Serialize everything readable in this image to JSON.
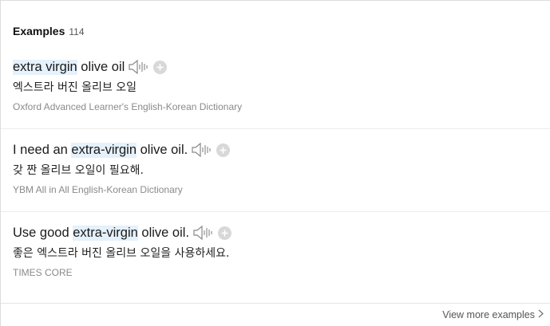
{
  "examples": {
    "title": "Examples",
    "count": "114",
    "items": [
      {
        "eng_pre": "",
        "eng_hl": "extra virgin",
        "eng_post": " olive oil",
        "korean": "엑스트라 버진 올리브 오일",
        "source": "Oxford Advanced Learner's English-Korean Dictionary"
      },
      {
        "eng_pre": "I need an ",
        "eng_hl": "extra-virgin",
        "eng_post": " olive oil.",
        "korean": "갖 짠 올리브 오일이 필요해.",
        "source": "YBM All in All English-Korean Dictionary"
      },
      {
        "eng_pre": "Use good ",
        "eng_hl": "extra-virgin",
        "eng_post": " olive oil.",
        "korean": "좋은 엑스트라 버진 올리브 오일을 사용하세요.",
        "source": "TIMES CORE"
      }
    ],
    "view_more": "View more examples",
    "icons": {
      "audio": "speaker-icon",
      "add": "plus-circle-icon",
      "more": "chevron-right-icon"
    },
    "colors": {
      "highlight": "#e5f1fb",
      "source_text": "#8a8a8a"
    }
  }
}
